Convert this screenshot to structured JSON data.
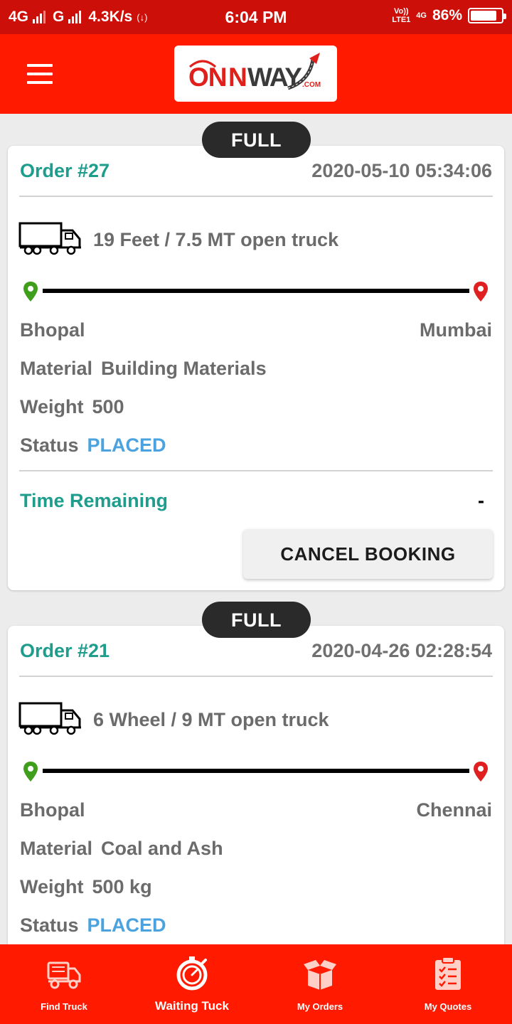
{
  "status_bar": {
    "network_1": "4G",
    "network_2": "G",
    "speed": "4.3K/s",
    "hotspot": "(↓)",
    "time": "6:04 PM",
    "volte_top": "Vo))",
    "volte_bottom": "LTE1",
    "network_3": "4G",
    "battery_text": "86%",
    "battery_level": 0.86
  },
  "header": {
    "menu_icon": "hamburger-menu-icon",
    "logo_text": "ONNWAY",
    "logo_suffix": ".COM"
  },
  "orders": [
    {
      "load_type": "FULL",
      "order_label": "Order #27",
      "date": "2020-05-10 05:34:06",
      "truck": "19 Feet / 7.5 MT open truck",
      "from": "Bhopal",
      "to": "Mumbai",
      "material_label": "Material",
      "material": "Building Materials",
      "weight_label": "Weight",
      "weight": "500",
      "status_label": "Status",
      "status": "PLACED",
      "time_remaining_label": "Time Remaining",
      "time_remaining": "-",
      "cancel_label": "CANCEL BOOKING"
    },
    {
      "load_type": "FULL",
      "order_label": "Order #21",
      "date": "2020-04-26 02:28:54",
      "truck": "6 Wheel / 9 MT open truck",
      "from": "Bhopal",
      "to": "Chennai",
      "material_label": "Material",
      "material": "Coal and Ash",
      "weight_label": "Weight",
      "weight": "500 kg",
      "status_label": "Status",
      "status": "PLACED"
    }
  ],
  "bottom_nav": [
    {
      "label": "Find Truck",
      "icon": "truck-icon",
      "active": false
    },
    {
      "label": "Waiting Tuck",
      "icon": "stopwatch-icon",
      "active": true
    },
    {
      "label": "My Orders",
      "icon": "open-box-icon",
      "active": false
    },
    {
      "label": "My Quotes",
      "icon": "clipboard-checklist-icon",
      "active": false
    }
  ],
  "colors": {
    "app_bar": "#ff1a00",
    "status_bar": "#cc0f08",
    "order_teal": "#1e9c8c",
    "status_blue": "#4aa3df",
    "pin_green": "#3f9e1c",
    "pin_red": "#e02020"
  }
}
